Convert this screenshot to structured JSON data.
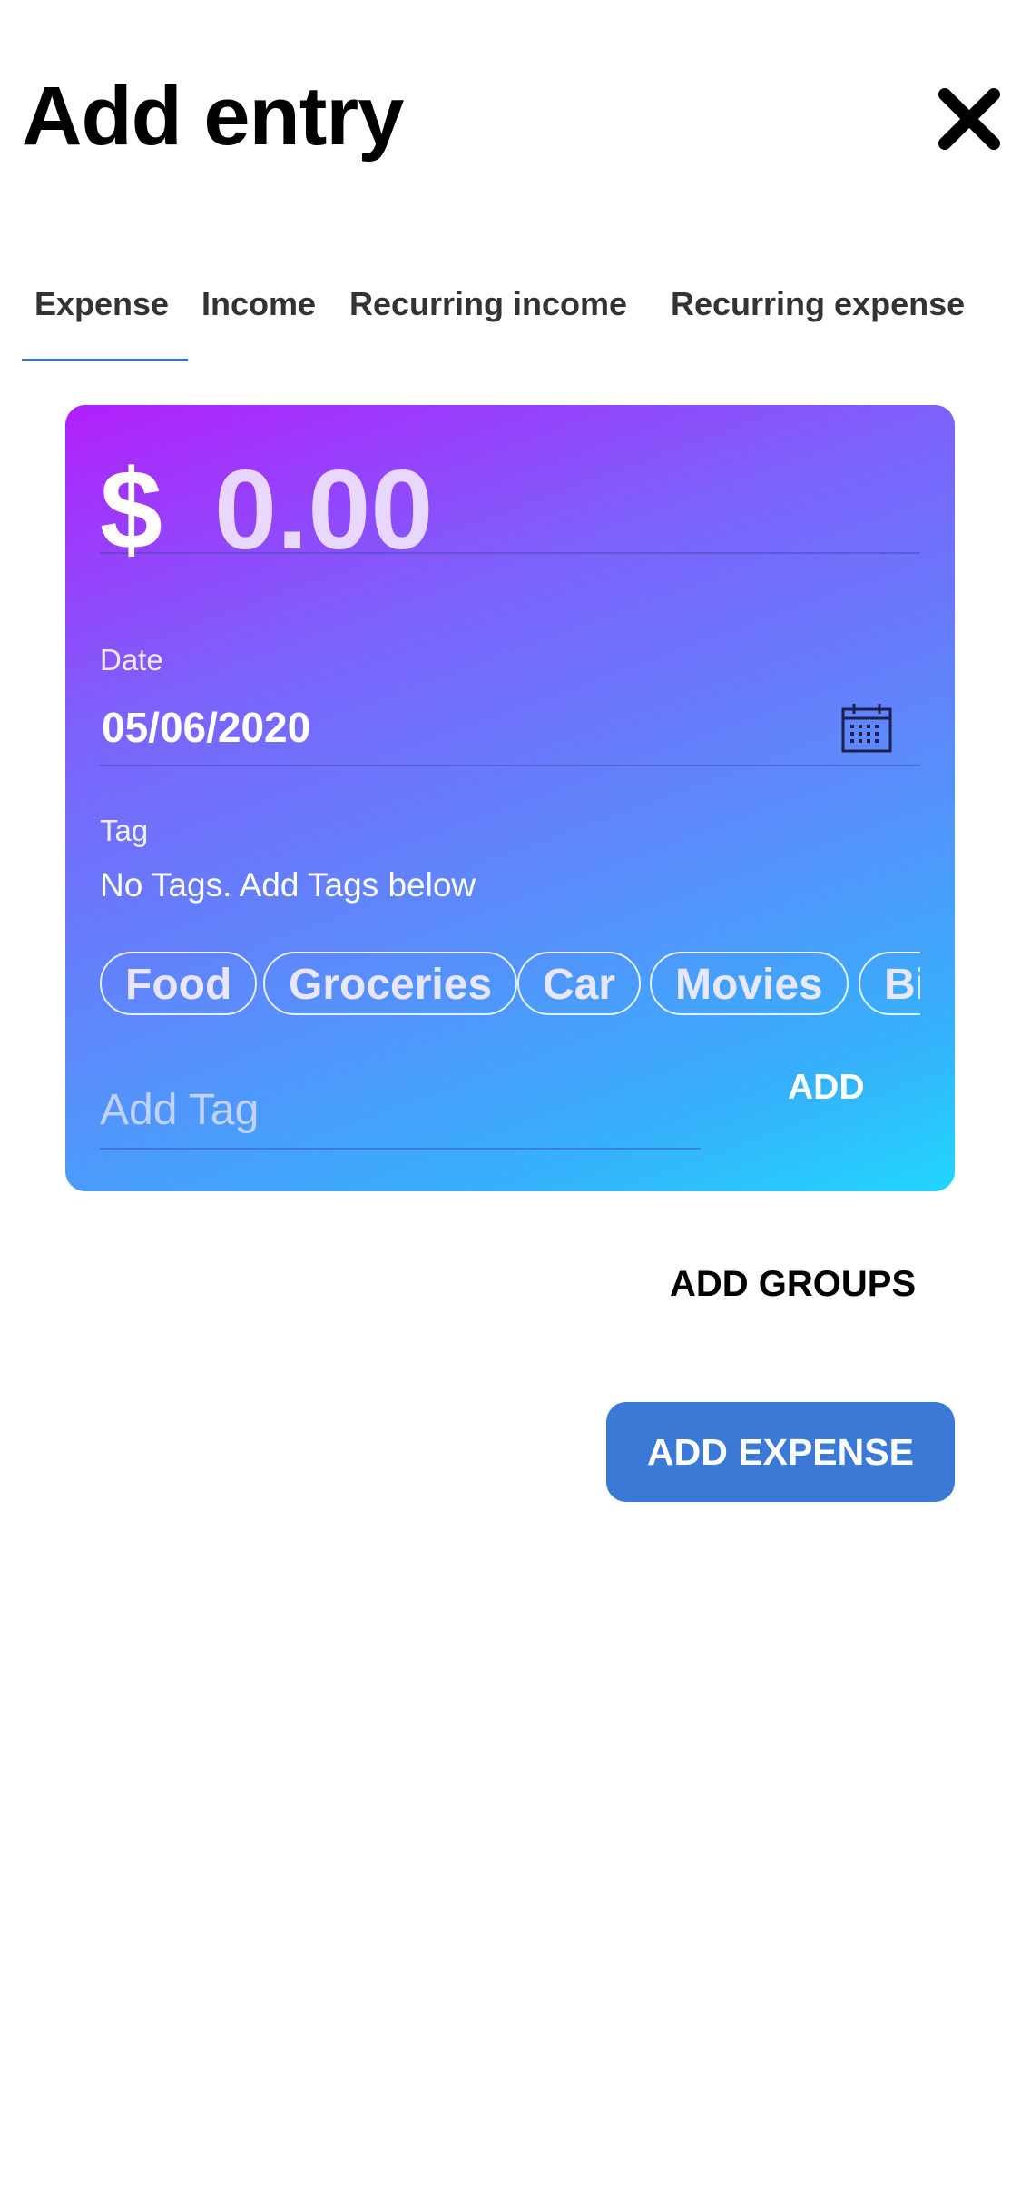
{
  "header": {
    "title": "Add entry",
    "close_icon": "close-icon"
  },
  "tabs": [
    {
      "label": "Expense",
      "active": true
    },
    {
      "label": "Income",
      "active": false
    },
    {
      "label": "Recurring income",
      "active": false
    },
    {
      "label": "Recurring expense",
      "active": false
    }
  ],
  "card": {
    "currency_symbol": "$",
    "amount": "0.00",
    "date_label": "Date",
    "date_value": "05/06/2020",
    "date_icon": "calendar-icon",
    "tag_label": "Tag",
    "tags_note": "No Tags. Add Tags below",
    "chips": [
      "Food",
      "Groceries",
      "Car",
      "Movies",
      "Bi"
    ],
    "add_tag_placeholder": "Add Tag",
    "add_label": "ADD",
    "gradient": [
      "#b21ffb",
      "#21d6fc"
    ]
  },
  "actions": {
    "add_groups_label": "ADD GROUPS",
    "add_expense_label": "ADD EXPENSE",
    "add_expense_color": "#3a7ad6"
  }
}
